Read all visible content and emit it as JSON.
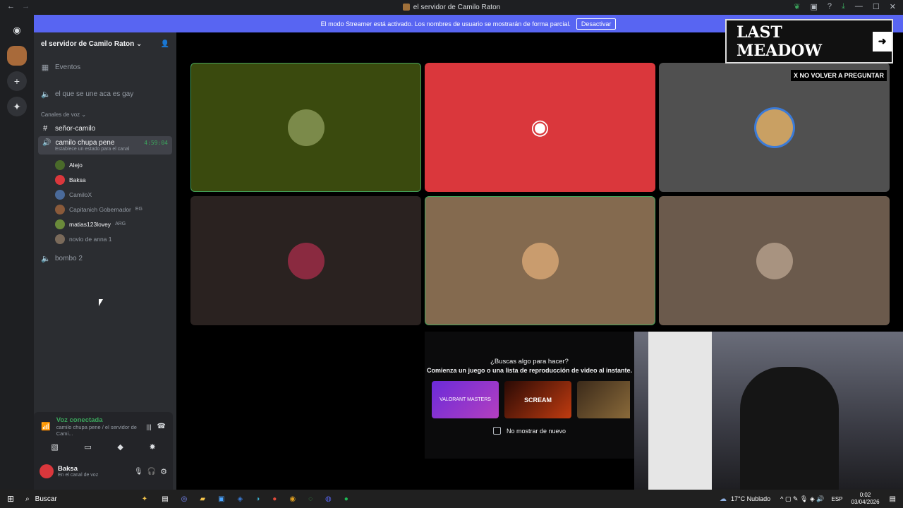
{
  "window": {
    "title": "el servidor de Camilo Raton"
  },
  "banner": {
    "text": "El modo Streamer está activado. Los nombres de usuario se mostrarán de forma parcial.",
    "button": "Desactivar"
  },
  "server": {
    "name": "el servidor de Camilo Raton"
  },
  "channels": {
    "events": "Eventos",
    "text1": "el que se une aca es gay",
    "voice_category": "Canales de voz",
    "text2": "señor-camilo",
    "active_voice": {
      "name": "camilo chupa pene",
      "timer": "4:59:04",
      "status": "Establece un estado para el canal"
    },
    "voice2": "bombo 2"
  },
  "voice_users": [
    {
      "name": "Alejo",
      "color": "#f2f3f5"
    },
    {
      "name": "Baksa",
      "color": "#f2f3f5"
    },
    {
      "name": "CamiloX",
      "color": "#949ba4"
    },
    {
      "name": "Capitanich Gobernador",
      "color": "#949ba4",
      "badge": "EG"
    },
    {
      "name": "matias123lovey",
      "color": "#f2f3f5",
      "badge": "ARG"
    },
    {
      "name": "novio de anna 1",
      "color": "#949ba4"
    }
  ],
  "voice_connected": {
    "title": "Voz conectada",
    "subtitle": "camilo chupa pene / el servidor de Cami..."
  },
  "user_panel": {
    "name": "Baksa",
    "status": "En el canal de voz"
  },
  "promo": {
    "title": "¿Buscas algo para hacer?",
    "subtitle": "Comienza un juego o una lista de reproducción de video al instante.",
    "checkbox": "No mostrar de nuevo",
    "game1": "VALORANT MASTERS",
    "game2": "SCREAM"
  },
  "ad": {
    "title": "LAST MEADOW",
    "button": "X NO VOLVER A PREGUNTAR"
  },
  "taskbar": {
    "search": "Buscar",
    "weather": "17°C  Nublado",
    "lang": "ESP",
    "time": "0:02",
    "date": "03/04/2026"
  },
  "colors": {
    "tile1": "#3a4a0e",
    "tile2": "#da373c",
    "tile3": "#505050",
    "tile4": "#2a2220",
    "tile5": "#846a4f",
    "tile6": "#6b5a4c"
  }
}
